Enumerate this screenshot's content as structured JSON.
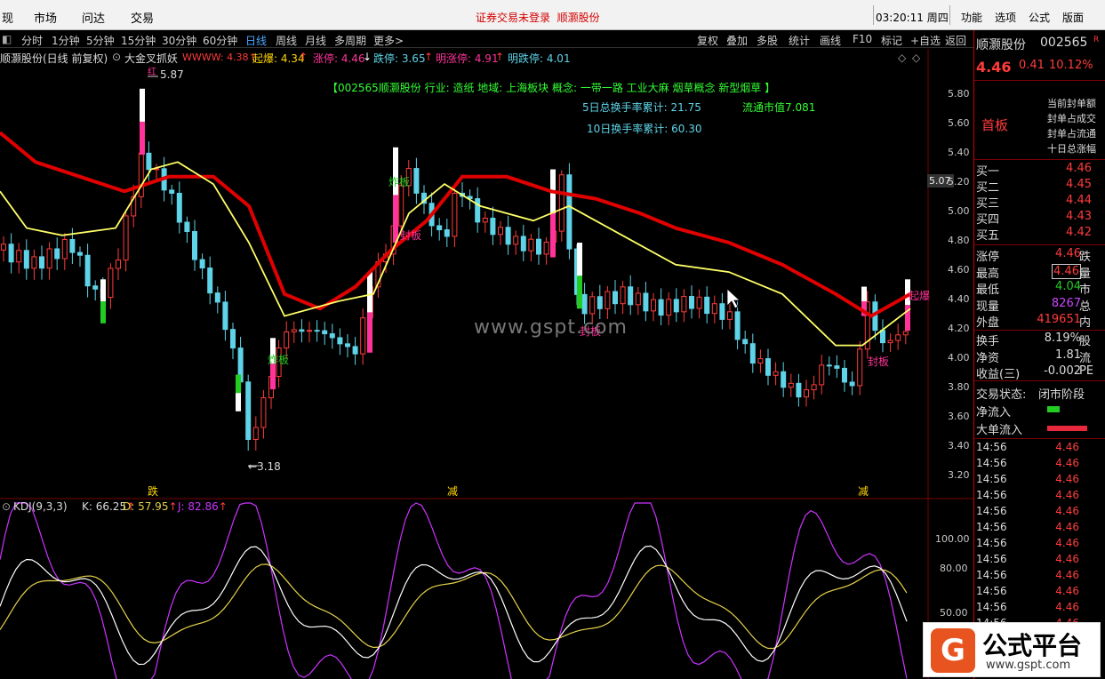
{
  "menubar": {
    "items": [
      "现",
      "市场",
      "问达",
      "交易"
    ],
    "notice": "证券交易未登录",
    "notice_stock": "顺灏股份",
    "clock": "03:20:11 周四",
    "right_items": [
      "功能",
      "选项",
      "公式",
      "版面"
    ]
  },
  "toolbar": {
    "periods": [
      "分时",
      "1分钟",
      "5分钟",
      "15分钟",
      "30分钟",
      "60分钟",
      "日线",
      "周线",
      "月线",
      "多周期",
      "更多"
    ],
    "more_arrow": ">",
    "active_period": "日线",
    "tools": [
      "复权",
      "叠加",
      "多股",
      "统计",
      "画线",
      "F10",
      "标记",
      "+自选",
      "返回"
    ]
  },
  "indicator_line": {
    "stock_info": "顺灏股份(日线 前复权)",
    "indicator": "大金叉抓妖",
    "www_label": "WWWW: 4.38",
    "qibao": "起爆: 4.34",
    "zhangting": "涨停: 4.46",
    "dieting": "跌停: 3.65",
    "ming_zhangting": "明涨停: 4.91",
    "ming_dieting": "明跌停: 4.01",
    "up_arrow": "↑",
    "down_arrow": "↓",
    "diamond": "◇"
  },
  "banner": {
    "concept": "【002565顺灏股份 行业: 造纸 地域: 上海板块 概念: 一带一路 工业大麻 烟草概念 新型烟草 】",
    "turnover5": "5日总换手率累计: 21.75",
    "turnover10": "10日换手率累计: 60.30",
    "float_cap": "流通市值7.081"
  },
  "price_axis": [
    "5.80",
    "5.60",
    "5.40",
    "5.20",
    "5.00",
    "4.80",
    "4.60",
    "4.40",
    "4.20",
    "4.00",
    "3.80",
    "3.60",
    "3.40",
    "3.20"
  ],
  "current_price_tag": "5.07",
  "high_mark": "5.87",
  "low_mark": "3.18",
  "signal_labels": {
    "zhaban": "炸板",
    "fengban": "封板",
    "qibao": "起爆",
    "red_mark": "红"
  },
  "bottom_markers": [
    "跌",
    "减",
    "减"
  ],
  "kdj": {
    "title": "KDJ(9,3,3)",
    "k": "K: 66.25",
    "d": "D: 57.95",
    "j": "J: 82.86",
    "up_arrow": "↑",
    "axis": [
      "100.00",
      "80.00",
      "50.00"
    ]
  },
  "quote": {
    "name": "顺灏股份",
    "code": "002565",
    "r_mark": "R",
    "price": "4.46",
    "change": "0.41",
    "pct": "10.12%",
    "board": "首板",
    "board_notes": [
      "当前封单额",
      "封单占成交",
      "封单占流通",
      "十日总涨幅"
    ],
    "bids": [
      {
        "label": "买一",
        "price": "4.46"
      },
      {
        "label": "买二",
        "price": "4.45"
      },
      {
        "label": "买三",
        "price": "4.44"
      },
      {
        "label": "买四",
        "price": "4.43"
      },
      {
        "label": "买五",
        "price": "4.42"
      }
    ],
    "stats": [
      {
        "label": "涨停",
        "value": "4.46",
        "tail": "跌"
      },
      {
        "label": "最高",
        "value": "4.46",
        "tail": "量"
      },
      {
        "label": "最低",
        "value": "4.04",
        "tail": "市"
      },
      {
        "label": "现量",
        "value": "8267",
        "tail": "总"
      },
      {
        "label": "外盘",
        "value": "419651",
        "tail": "内"
      }
    ],
    "stats2": [
      {
        "label": "换手",
        "value": "8.19%",
        "tail": "股"
      },
      {
        "label": "净资",
        "value": "1.81",
        "tail": "流"
      },
      {
        "label": "收益(三)",
        "value": "-0.002",
        "tail": "PE"
      }
    ],
    "trade_state_label": "交易状态:",
    "trade_state": "闭市阶段",
    "net_inflow": "净流入",
    "big_inflow": "大单流入",
    "ticks": [
      {
        "time": "14:56",
        "price": "4.46"
      },
      {
        "time": "14:56",
        "price": "4.46"
      },
      {
        "time": "14:56",
        "price": "4.46"
      },
      {
        "time": "14:56",
        "price": "4.46"
      },
      {
        "time": "14:56",
        "price": "4.46"
      },
      {
        "time": "14:56",
        "price": "4.46"
      },
      {
        "time": "14:56",
        "price": "4.46"
      },
      {
        "time": "14:56",
        "price": "4.46"
      },
      {
        "time": "14:56",
        "price": "4.46"
      },
      {
        "time": "14:56",
        "price": "4.46"
      },
      {
        "time": "14:56",
        "price": "4.46"
      },
      {
        "time": "14:56",
        "price": "4.46"
      }
    ]
  },
  "watermark": "www.gspt.com",
  "logo": {
    "name": "公式平台",
    "url": "www.gspt.com"
  },
  "colors": {
    "up": "#ff3b3b",
    "down": "#5fd3e8",
    "ma_red": "#e00000",
    "ma_yellow": "#ffff66",
    "signal_pink": "#ff3399",
    "signal_green": "#22cc22"
  }
}
